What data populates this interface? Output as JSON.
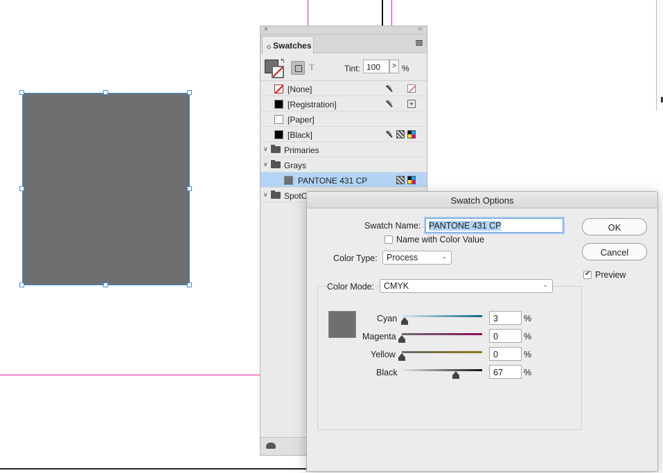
{
  "swatches_panel": {
    "close_glyph": "×",
    "collapse_glyph": "‹‹",
    "tab_title": "Swatches",
    "tab_arrows": "◇",
    "tint_label": "Tint:",
    "tint_value": "100",
    "tint_arrow": ">",
    "tint_unit": "%",
    "text_button_glyph": "T",
    "swap_glyph": "↰",
    "swatches": [
      {
        "name": "[None]"
      },
      {
        "name": "[Registration]"
      },
      {
        "name": "[Paper]"
      },
      {
        "name": "[Black]"
      }
    ],
    "groups": [
      {
        "name": "Primaries",
        "twist": "∨"
      },
      {
        "name": "Grays",
        "twist": "∨",
        "children": [
          {
            "name": "PANTONE 431 CP"
          }
        ]
      },
      {
        "name": "SpotCo",
        "twist": "∨"
      }
    ]
  },
  "dialog": {
    "title": "Swatch Options",
    "swatch_name_label": "Swatch Name:",
    "swatch_name_value": "PANTONE 431 CP",
    "name_with_color_value_label": "Name with Color Value",
    "name_with_color_value_checked": false,
    "color_type_label": "Color Type:",
    "color_type_value": "Process",
    "color_mode_label": "Color Mode:",
    "color_mode_value": "CMYK",
    "ok_label": "OK",
    "cancel_label": "Cancel",
    "preview_label": "Preview",
    "preview_checked": true,
    "percent_unit": "%",
    "sliders": [
      {
        "label": "Cyan",
        "value": "3"
      },
      {
        "label": "Magenta",
        "value": "0"
      },
      {
        "label": "Yellow",
        "value": "0"
      },
      {
        "label": "Black",
        "value": "67"
      }
    ]
  },
  "colors": {
    "swatch_gray": "#6d6f71",
    "selection_blue": "#4a90e2",
    "guide_magenta": "#e21fa3",
    "guide_purple": "#9b3fd0",
    "row_selected": "#b3d4f5"
  }
}
